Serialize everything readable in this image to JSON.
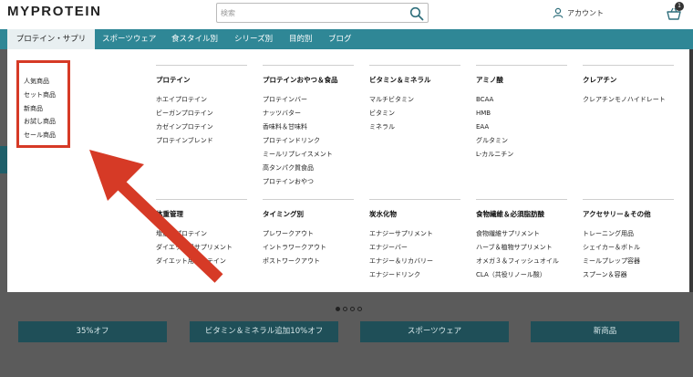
{
  "header": {
    "logo": "MYPROTEIN",
    "search_placeholder": "検索",
    "account_label": "アカウント",
    "cart_count": "1"
  },
  "nav": {
    "items": [
      {
        "label": "プロテイン・サプリ"
      },
      {
        "label": "スポーツウェア"
      },
      {
        "label": "食スタイル別"
      },
      {
        "label": "シリーズ別"
      },
      {
        "label": "目的別"
      },
      {
        "label": "ブログ"
      }
    ]
  },
  "dropdown": {
    "left_links": [
      "人気商品",
      "セット商品",
      "新商品",
      "お試し商品",
      "セール商品"
    ],
    "columns": [
      {
        "heading": "プロテイン",
        "links": [
          "ホエイプロテイン",
          "ビーガンプロテイン",
          "カゼインプロテイン",
          "プロテインブレンド"
        ]
      },
      {
        "heading": "プロテインおやつ＆食品",
        "links": [
          "プロテインバー",
          "ナッツバター",
          "香味料＆甘味料",
          "プロテインドリンク",
          "ミールリプレイスメント",
          "高タンパク質食品",
          "プロテインおやつ"
        ]
      },
      {
        "heading": "ビタミン＆ミネラル",
        "links": [
          "マルチビタミン",
          "ビタミン",
          "ミネラル"
        ]
      },
      {
        "heading": "アミノ酸",
        "links": [
          "BCAA",
          "HMB",
          "EAA",
          "グルタミン",
          "L-カルニチン"
        ]
      },
      {
        "heading": "クレアチン",
        "links": [
          "クレアチンモノハイドレート"
        ]
      },
      {
        "heading": "体重管理",
        "links": [
          "増量用プロテイン",
          "ダイエット用サプリメント",
          "ダイエット用プロテイン"
        ]
      },
      {
        "heading": "タイミング別",
        "links": [
          "プレワークアウト",
          "イントラワークアウト",
          "ポストワークアウト"
        ]
      },
      {
        "heading": "炭水化物",
        "links": [
          "エナジーサプリメント",
          "エナジーバー",
          "エナジー＆リカバリー",
          "エナジードリンク"
        ]
      },
      {
        "heading": "食物繊維＆必須脂肪酸",
        "links": [
          "食物繊維サプリメント",
          "ハーブ＆植物サプリメント",
          "オメガ３＆フィッシュオイル",
          "CLA（共役リノール酸）"
        ]
      },
      {
        "heading": "アクセサリー＆その他",
        "links": [
          "トレーニング用品",
          "シェイカー＆ボトル",
          "ミールプレップ容器",
          "スプーン＆容器"
        ]
      }
    ]
  },
  "promo_buttons": [
    "35%オフ",
    "ビタミン＆ミネラル追加10%オフ",
    "スポーツウェア",
    "新商品"
  ],
  "colors": {
    "nav_bg": "#2f8796",
    "annotation": "#d63a26",
    "promo_bg": "#1f4f58"
  }
}
